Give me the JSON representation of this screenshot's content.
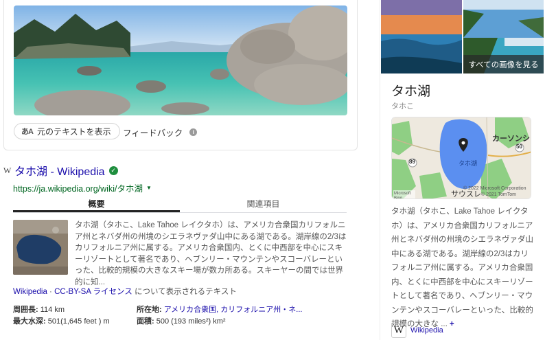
{
  "top": {
    "original_text_label": "元のテキストを表示",
    "original_text_icon": "あA",
    "feedback_label": "フィードバック"
  },
  "result": {
    "title": "タホ湖 - Wikipedia",
    "url": "https://ja.wikipedia.org/wiki/タホ湖",
    "tabs": [
      {
        "label": "概要",
        "active": true
      },
      {
        "label": "関連項目",
        "active": false
      }
    ],
    "snippet": "タホ湖（タホこ、Lake Tahoe レイクタホ）は、アメリカ合衆国カリフォルニア州とネバダ州の州境のシエラネヴァダ山中にある湖である。湖岸線の2/3はカリフォルニア州に属する。アメリカ合衆国内、とくに中西部を中心にスキーリゾートとして著名であり、ヘブンリー・マウンテンやスコーバレーといった、比較的規模の大きなスキー場が数カ所ある。スキーヤーの間では世界的に知...",
    "license": {
      "wikipedia": "Wikipedia",
      "separator": " · ",
      "cc": "CC-BY-SA ライセンス",
      "tail": " について表示されるテキスト"
    },
    "facts": [
      {
        "key": "周囲長:",
        "value": "114 km"
      },
      {
        "key": "所在地:",
        "value": "アメリカ合衆国, カリフォルニア州・ネ..."
      },
      {
        "key": "最大水深:",
        "value": "501(1,645 feet ) m"
      },
      {
        "key": "面積:",
        "value": "500 (193 miles²) km²"
      }
    ]
  },
  "panel": {
    "all_images_label": "すべての画像を見る",
    "title": "タホ湖",
    "subtitle": "タホこ",
    "map": {
      "lake_label": "タホ湖",
      "city_label": "カーソンシ",
      "road_label": "50",
      "road_label_2": "89",
      "south_label": "サウスレ",
      "copyright_1": "© 2022 Microsoft Corporation",
      "copyright_2": "© 2021 TomTom",
      "brand": "Microsoft Bing"
    },
    "description": "タホ湖（タホこ、Lake Tahoe レイクタホ）は、アメリカ合衆国カリフォルニア州とネバダ州の州境のシエラネヴァダ山中にある湖である。湖岸線の2/3はカリフォルニア州に属する。アメリカ合衆国内、とくに中西部を中心にスキーリゾートとして著名であり、ヘブンリー・マウンテンやスコーバレーといった、比較的規模の大きな ...",
    "more": "+",
    "source_icon": "W",
    "source_label": "Wikipedia"
  },
  "colors": {
    "link": "#1a0dab",
    "url": "#006621",
    "verified": "#1e8e3e",
    "lake_blue": "#5b8ff0"
  },
  "icons": {
    "info": "info-icon",
    "verified": "verified-check-icon",
    "map_pin": "map-pin-icon",
    "caret": "caret-down-icon"
  }
}
